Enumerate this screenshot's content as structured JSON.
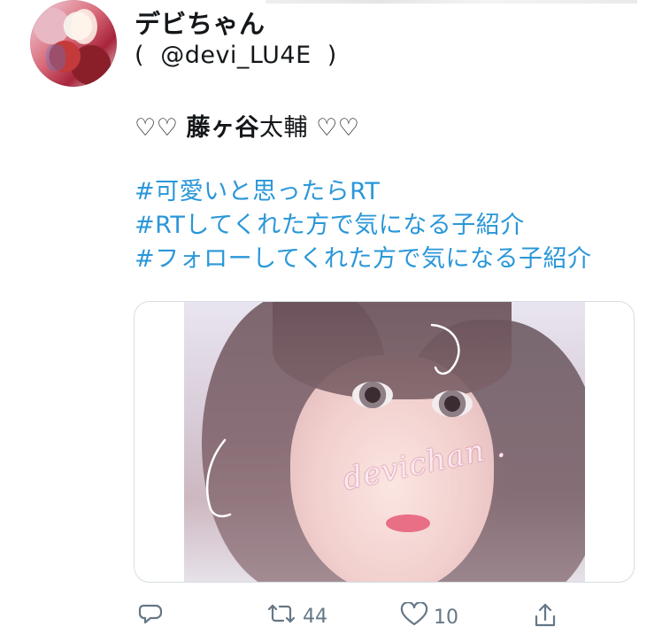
{
  "tweet": {
    "display_name": "デビちゃん",
    "handle": "(  @devi_LU4E  )",
    "text_prefix": "♡♡ ",
    "text_bold": "藤ヶ谷",
    "text_rest": "太輔 ♡♡",
    "hashtags": [
      "#可愛いと思ったらRT",
      "#RTしてくれた方で気になる子紹介",
      "#フォローしてくれた方で気になる子紹介"
    ],
    "media": {
      "watermark": "devichan ."
    }
  },
  "actions": {
    "reply_icon": "reply-icon",
    "retweet_icon": "retweet-icon",
    "retweet_count": "44",
    "like_icon": "heart-icon",
    "like_count": "10",
    "share_icon": "share-icon"
  },
  "colors": {
    "hashtag": "#2a97d8",
    "action_gray": "#657786",
    "card_border": "#d6dde3"
  }
}
